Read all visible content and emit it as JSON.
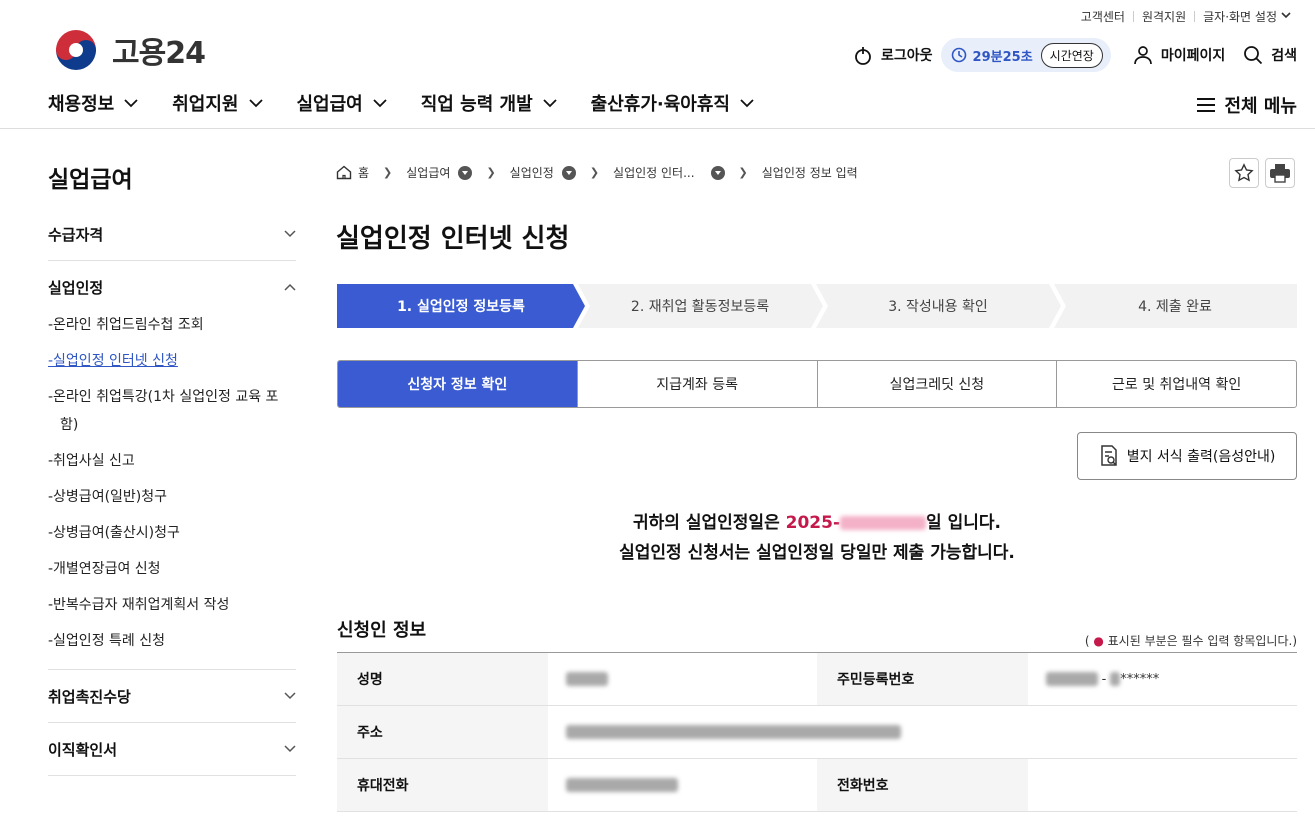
{
  "utility": [
    "고객센터",
    "원격지원",
    "글자·화면 설정"
  ],
  "logo": {
    "text": "고용24"
  },
  "top": {
    "logout": "로그아웃",
    "timer": "29분25초",
    "extend": "시간연장",
    "mypage": "마이페이지",
    "search": "검색"
  },
  "gnb": [
    "채용정보",
    "취업지원",
    "실업급여",
    "직업 능력 개발",
    "출산휴가·육아휴직"
  ],
  "all_menu": "전체 메뉴",
  "sidebar": {
    "title": "실업급여",
    "sections": [
      "수급자격",
      "실업인정",
      "취업촉진수당",
      "이직확인서"
    ],
    "sub_items": [
      "-온라인 취업드림수첩 조회",
      "-실업인정 인터넷 신청",
      "-온라인 취업특강(1차 실업인정 교육 포함)",
      "-취업사실 신고",
      "-상병급여(일반)청구",
      "-상병급여(출산시)청구",
      "-개별연장급여 신청",
      "-반복수급자 재취업계획서 작성",
      "-실업인정 특례 신청"
    ]
  },
  "breadcrumb": [
    "홈",
    "실업급여",
    "실업인정",
    "실업인정 인터...",
    "실업인정 정보 입력"
  ],
  "page_title": "실업인정 인터넷 신청",
  "steps": [
    "1. 실업인정 정보등록",
    "2. 재취업 활동정보등록",
    "3. 작성내용 확인",
    "4. 제출 완료"
  ],
  "tabs": [
    "신청자 정보 확인",
    "지급계좌 등록",
    "실업크레딧 신청",
    "근로 및 취업내역 확인"
  ],
  "print_button": "별지 서식 출력(음성안내)",
  "notice": {
    "line1_prefix": "귀하의 실업인정일은 ",
    "line1_date": "2025-",
    "line1_suffix": "일 입니다.",
    "line2": "실업인정 신청서는 실업인정일 당일만 제출 가능합니다."
  },
  "applicant": {
    "title": "신청인 정보",
    "required_note_prefix": "( ",
    "required_note_dot": "●",
    "required_note_suffix": " 표시된 부분은 필수 입력 항목입니다.)",
    "labels": {
      "name": "성명",
      "rrn": "주민등록번호",
      "address": "주소",
      "mobile": "휴대전화",
      "phone": "전화번호"
    },
    "rrn_suffix": "******"
  },
  "colors": {
    "accent": "#3a5bd1",
    "date": "#c4194a",
    "timer_text": "#2f56c4"
  }
}
